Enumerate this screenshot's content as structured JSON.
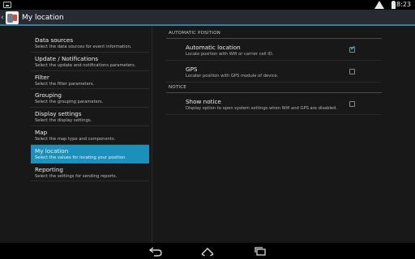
{
  "status_bar": {
    "time": "18:23",
    "icons": [
      "notification-icon",
      "wifi-icon",
      "battery-icon"
    ]
  },
  "action_bar": {
    "title": "My location",
    "up_glyph": "‹",
    "accent": "#2f7fa9"
  },
  "nav": {
    "selected_color": "#1c8fbb",
    "items": [
      {
        "title": "Data sources",
        "summary": "Select the data sources for event information.",
        "selected": false
      },
      {
        "title": "Update / Notifications",
        "summary": "Select the update and notifications parameters.",
        "selected": false
      },
      {
        "title": "Filter",
        "summary": "Select the filter parameters.",
        "selected": false
      },
      {
        "title": "Grouping",
        "summary": "Select the grouping parameters.",
        "selected": false
      },
      {
        "title": "Display settings",
        "summary": "Select the display settings.",
        "selected": false
      },
      {
        "title": "Map",
        "summary": "Select the map type and components.",
        "selected": false
      },
      {
        "title": "My location",
        "summary": "Select the values for locating your position.",
        "selected": true
      },
      {
        "title": "Reporting",
        "summary": "Select the settings for sending reports.",
        "selected": false
      }
    ]
  },
  "detail": {
    "categories": [
      {
        "header": "AUTOMATIC POSITION",
        "prefs": [
          {
            "title": "Automatic location",
            "summary": "Locate position with Wifi or carrier cell ID.",
            "checked": true
          },
          {
            "title": "GPS",
            "summary": "Locater position with GPS module of device.",
            "checked": false
          }
        ]
      },
      {
        "header": "NOTICE",
        "prefs": [
          {
            "title": "Show notice",
            "summary": "Display option to open system settings when Wifi and GPS are disabled.",
            "checked": false
          }
        ]
      }
    ],
    "checkmark_glyph": "✔",
    "check_color": "#33b5e5"
  },
  "nav_bar": {
    "icons": [
      "back-icon",
      "home-icon",
      "recent-apps-icon"
    ]
  }
}
